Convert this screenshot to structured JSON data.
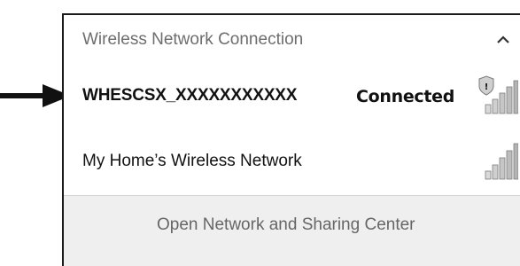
{
  "section": {
    "title": "Wireless Network Connection"
  },
  "networks": [
    {
      "name": "WHESCSX_XXXXXXXXXXX",
      "status": "Connected",
      "secured": true,
      "selected": true
    },
    {
      "name": "My Home’s Wireless Network",
      "status": "",
      "secured": false,
      "selected": false
    }
  ],
  "footer": {
    "link_label": "Open Network and Sharing Center"
  },
  "icons": {
    "pointer": "arrow-right-icon",
    "collapse": "chevron-up-icon",
    "signal": "wifi-signal-icon",
    "shield": "shield-icon"
  },
  "colors": {
    "text": "#111111",
    "muted_text": "#6d6d6d",
    "footer_bg": "#efefef",
    "border": "#1a1a1a"
  }
}
